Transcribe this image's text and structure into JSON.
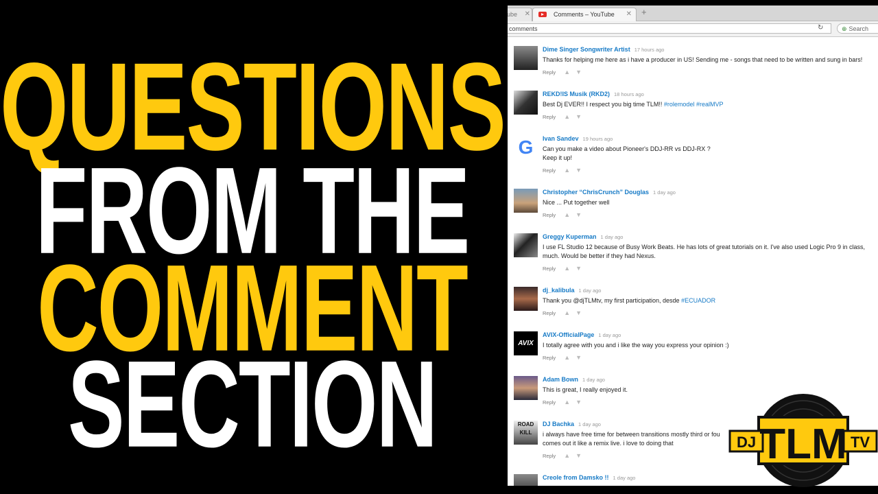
{
  "headline": {
    "line1": "QUESTIONS",
    "line2": "FROM THE",
    "line3": "COMMENT",
    "line4": "SECTION",
    "color_yellow": "#ffc90e",
    "color_white": "#ffffff"
  },
  "browser": {
    "prev_tab_label": "ube",
    "active_tab_label": "Comments – YouTube",
    "url_text": "comments",
    "search_placeholder": "Search"
  },
  "comments": [
    {
      "author": "Dime Singer Songwriter Artist",
      "time": "17 hours ago",
      "lines": [
        "Thanks for helping me here as i have a producer in US! Sending me - songs that need to be written and sung in bars!"
      ],
      "reply": "Reply"
    },
    {
      "author": "REKD!IS Musik (RKD2)",
      "time": "18 hours ago",
      "lines": [
        "Best Dj EVER!! I respect you big time TLM!!"
      ],
      "hashtags": "#rolemodel #realMVP",
      "reply": "Reply"
    },
    {
      "author": "Ivan Sandev",
      "time": "19 hours ago",
      "lines": [
        "Can you make a video about Pioneer's DDJ-RR vs DDJ-RX ?",
        "Keep it up!"
      ],
      "reply": "Reply"
    },
    {
      "author": "Christopher “ChrisCrunch” Douglas",
      "time": "1 day ago",
      "lines": [
        "Nice ... Put together well"
      ],
      "reply": "Reply"
    },
    {
      "author": "Greggy Kuperman",
      "time": "1 day ago",
      "lines": [
        "I use FL Studio 12 because of Busy Work Beats. He has lots of great tutorials on it. I've also used Logic Pro 9 in class,",
        "much. Would be better if they had Nexus."
      ],
      "reply": "Reply"
    },
    {
      "author": "dj_kalibula",
      "time": "1 day ago",
      "lines": [
        "Thank you @djTLMtv, my first participation, desde"
      ],
      "hashtags": "#ECUADOR",
      "reply": "Reply"
    },
    {
      "author": "AVIX-OfficialPage",
      "time": "1 day ago",
      "lines": [
        "I totally agree with you and i like the way you express your opinion :)"
      ],
      "reply": "Reply",
      "avatar_text": "AVIX"
    },
    {
      "author": "Adam Bown",
      "time": "1 day ago",
      "lines": [
        "This is great, I really enjoyed it."
      ],
      "reply": "Reply"
    },
    {
      "author": "DJ Bachka",
      "time": "1 day ago",
      "lines": [
        "i always have free time for between transitions mostly third or fou",
        "comes out it like a remix live. i love to doing that"
      ],
      "reply": "Reply",
      "avatar_text": "ROAD KILL"
    },
    {
      "author": "Creole from Damsko !!",
      "time": "1 day ago",
      "lines": [],
      "reply": ""
    }
  ],
  "logo": {
    "left": "DJ",
    "center": "TLM",
    "right": "TV"
  }
}
